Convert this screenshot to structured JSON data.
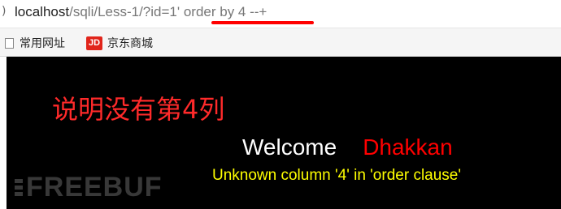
{
  "address_bar": {
    "url_host": "localhost",
    "url_path": "/sqli/Less-1/?id=1' order by 4 --+"
  },
  "bookmarks": [
    {
      "label": "常用网址",
      "icon": "page-icon"
    },
    {
      "label": "京东商城",
      "icon": "jd-logo-icon",
      "icon_text": "JD"
    }
  ],
  "page": {
    "annotation": "说明没有第4列",
    "welcome": "Welcome",
    "name": "Dhakkan",
    "error": "Unknown column '4' in 'order clause'",
    "watermark": "FREEBUF"
  },
  "colors": {
    "annotation": "#ff2a2a",
    "welcome": "#ffffff",
    "name": "#ff0000",
    "error": "#ffff00",
    "underline": "#ff0000",
    "background": "#000000"
  }
}
